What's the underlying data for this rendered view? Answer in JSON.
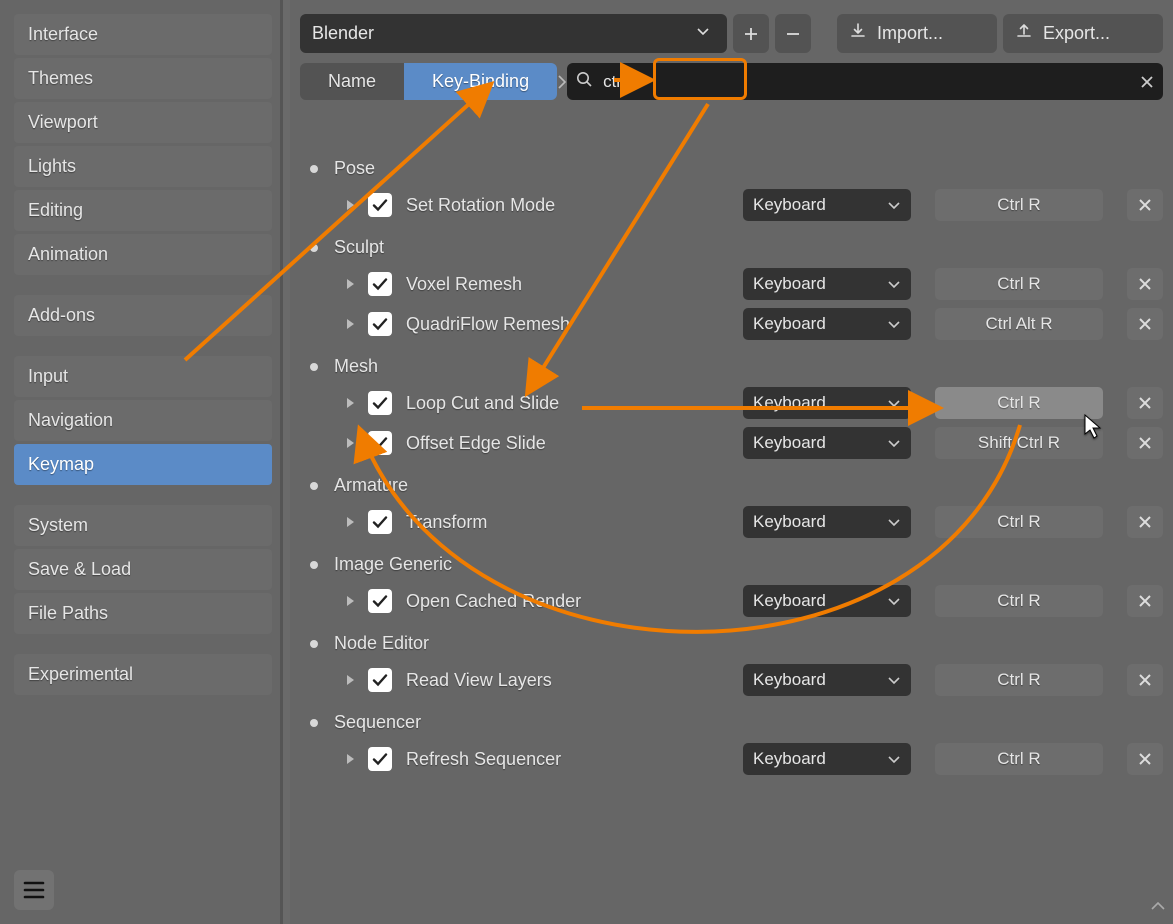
{
  "sidebar": {
    "groups": [
      [
        {
          "id": "interface",
          "label": "Interface"
        },
        {
          "id": "themes",
          "label": "Themes"
        },
        {
          "id": "viewport",
          "label": "Viewport"
        },
        {
          "id": "lights",
          "label": "Lights"
        },
        {
          "id": "editing",
          "label": "Editing"
        },
        {
          "id": "animation",
          "label": "Animation"
        }
      ],
      [
        {
          "id": "addons",
          "label": "Add-ons"
        }
      ],
      [
        {
          "id": "input",
          "label": "Input"
        },
        {
          "id": "navigation",
          "label": "Navigation"
        },
        {
          "id": "keymap",
          "label": "Keymap",
          "selected": true
        }
      ],
      [
        {
          "id": "system",
          "label": "System"
        },
        {
          "id": "saveload",
          "label": "Save & Load"
        },
        {
          "id": "filepaths",
          "label": "File Paths"
        }
      ],
      [
        {
          "id": "experimental",
          "label": "Experimental"
        }
      ]
    ]
  },
  "top": {
    "preset": "Blender",
    "import": "Import...",
    "export": "Export..."
  },
  "search": {
    "seg_name": "Name",
    "seg_keybinding": "Key-Binding",
    "value": "ctrl r"
  },
  "input_method": "Keyboard",
  "categories": [
    {
      "name": "Pose",
      "entries": [
        {
          "label": "Set Rotation Mode",
          "method": "Keyboard",
          "key": "Ctrl R"
        }
      ]
    },
    {
      "name": "Sculpt",
      "entries": [
        {
          "label": "Voxel Remesh",
          "method": "Keyboard",
          "key": "Ctrl R"
        },
        {
          "label": "QuadriFlow Remesh",
          "method": "Keyboard",
          "key": "Ctrl Alt R"
        }
      ]
    },
    {
      "name": "Mesh",
      "entries": [
        {
          "label": "Loop Cut and Slide",
          "method": "Keyboard",
          "key": "Ctrl R",
          "hover": true
        },
        {
          "label": "Offset Edge Slide",
          "method": "Keyboard",
          "key": "Shift Ctrl R"
        }
      ]
    },
    {
      "name": "Armature",
      "entries": [
        {
          "label": "Transform",
          "method": "Keyboard",
          "key": "Ctrl R"
        }
      ]
    },
    {
      "name": "Image Generic",
      "entries": [
        {
          "label": "Open Cached Render",
          "method": "Keyboard",
          "key": "Ctrl R"
        }
      ]
    },
    {
      "name": "Node Editor",
      "entries": [
        {
          "label": "Read View Layers",
          "method": "Keyboard",
          "key": "Ctrl R"
        }
      ]
    },
    {
      "name": "Sequencer",
      "entries": [
        {
          "label": "Refresh Sequencer",
          "method": "Keyboard",
          "key": "Ctrl R"
        }
      ]
    }
  ]
}
